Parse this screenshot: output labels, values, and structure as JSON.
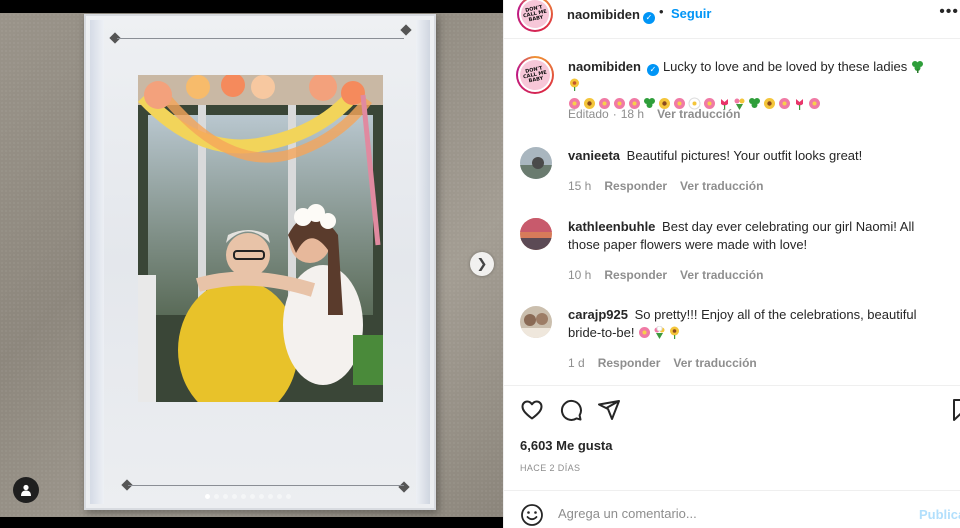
{
  "post": {
    "username": "naomibiden",
    "dot": "•",
    "follow_label": "Seguir",
    "avatar_lines": [
      "DON'T",
      "CALL ME",
      "BABY"
    ],
    "more_label": "•••"
  },
  "caption": {
    "username": "naomibiden",
    "text": "Lucky to love and be loved by these ladies",
    "edited": "Editado",
    "dot": "·",
    "time": "18 h",
    "translate": "Ver traducción"
  },
  "comments": [
    {
      "username": "vanieeta",
      "text": "Beautiful pictures! Your outfit looks great!",
      "time": "15 h",
      "reply": "Responder",
      "translate": "Ver traducción"
    },
    {
      "username": "kathleenbuhle",
      "text": "Best day ever celebrating our girl Naomi! All those paper flowers were made with love!",
      "time": "10 h",
      "reply": "Responder",
      "translate": "Ver traducción"
    },
    {
      "username": "carajp925",
      "text": "So pretty!!! Enjoy all of the celebrations, beautiful bride-to-be!",
      "time": "1 d",
      "reply": "Responder",
      "translate": "Ver traducción"
    }
  ],
  "actions": {
    "likes": "6,603 Me gusta",
    "date": "HACE 2 DÍAS"
  },
  "add_comment": {
    "placeholder": "Agrega un comentario...",
    "publish": "Publica"
  },
  "carousel": {
    "count": 10,
    "active_index": 0
  },
  "icons": {
    "like": "heart-icon",
    "comment": "comment-icon",
    "share": "share-icon",
    "save": "bookmark-icon",
    "emoji": "smile-icon",
    "next": "chevron-right-icon",
    "tag": "user-tag-icon"
  },
  "colors": {
    "link": "#0095f6",
    "muted": "#8e8e8e",
    "publish_disabled": "#b2dffc"
  }
}
